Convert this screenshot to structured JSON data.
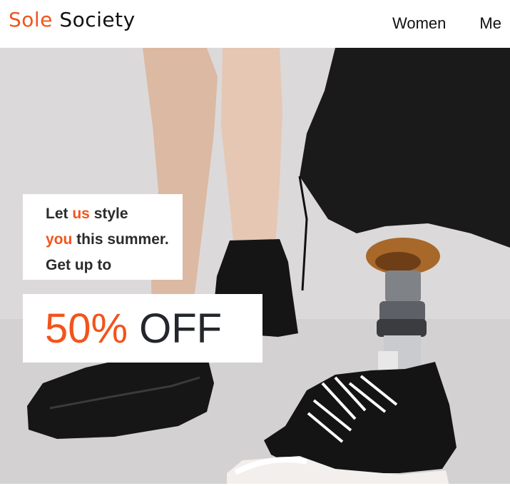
{
  "brand": {
    "first": "Sole",
    "second": "Society",
    "accent_color": "#f2541b"
  },
  "nav": {
    "items": [
      {
        "label": "Women"
      },
      {
        "label": "Me"
      }
    ]
  },
  "hero": {
    "image_description": "Legs in black sneakers, one a prosthetic leg",
    "promo": {
      "line1_a": "Let ",
      "line1_accent": "us",
      "line1_b": " style",
      "line2_accent": "you",
      "line2_b": " this summer.",
      "line3": "Get up to"
    },
    "discount": {
      "percent": "50%",
      "off": "OFF"
    }
  }
}
